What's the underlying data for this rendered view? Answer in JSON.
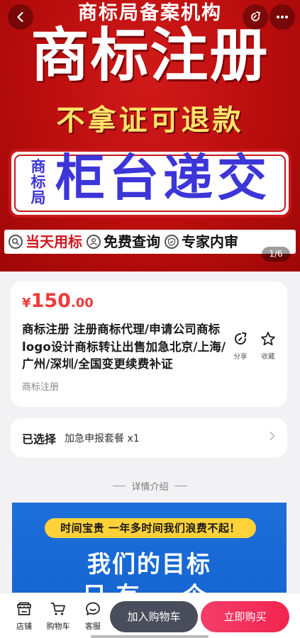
{
  "hero": {
    "top_text": "商标局备案机构",
    "main_text": "商标注册",
    "sub_text": "不拿证可退款",
    "box_side": "商标局",
    "box_main": "柜台递交",
    "strip": [
      "当天用标",
      "免费查询",
      "专家内审"
    ],
    "counter": "1/6"
  },
  "product": {
    "price_symbol": "¥",
    "price_int": "150",
    "price_dec": ".00",
    "title": "商标注册 注册商标代理/申请公司商标logo设计商标转让出售加急北京/上海/广州/深圳/全国变更续费补证",
    "category": "商标注册",
    "share_label": "分享",
    "favorite_label": "收藏"
  },
  "selection": {
    "label": "已选择",
    "value": "加急申报套餐 x1"
  },
  "detail": {
    "heading": "详情介绍",
    "pill": "时间宝贵 一年多时间我们浪费不起！",
    "big_line1": "我们的目标",
    "big_line2": "只有一个"
  },
  "bottom_bar": {
    "shop_label": "店铺",
    "cart_label": "购物车",
    "service_label": "客服",
    "add_cart_label": "加入购物车",
    "buy_now_label": "立即购买"
  },
  "colors": {
    "price_red": "#ef3b3b",
    "buy_button": "#f2244f",
    "cart_button": "#4a4e5c",
    "hero_red": "#b90d0d",
    "detail_blue": "#1565d2"
  }
}
